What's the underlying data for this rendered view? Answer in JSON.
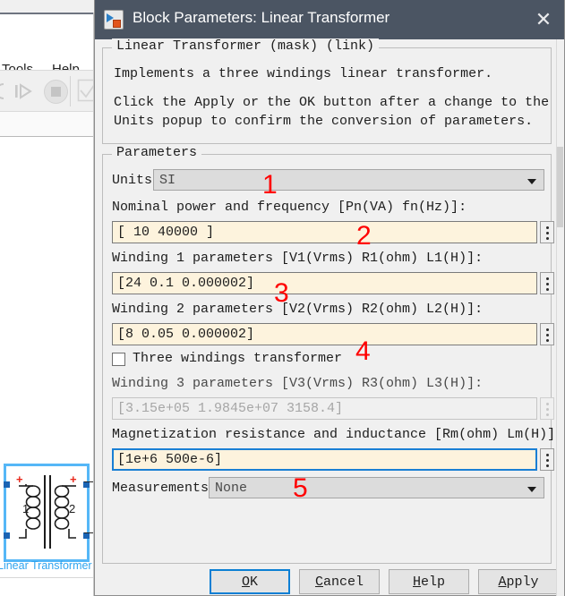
{
  "background": {
    "menus": [
      {
        "mnemonic": "T",
        "rest": "ools"
      },
      {
        "mnemonic": "H",
        "rest": "elp"
      }
    ],
    "block": {
      "label": "Linear Transformer",
      "winding1_number": "1",
      "winding2_number": "2",
      "polarity_mark": "+"
    }
  },
  "dialog": {
    "title": "Block Parameters: Linear Transformer",
    "close_label": "✕",
    "icon": "simulink-block-icon",
    "description": {
      "legend": "Linear Transformer (mask) (link)",
      "lines": [
        "Implements a three windings linear transformer.",
        "",
        "Click the Apply or the OK button after a change to the",
        "Units popup to confirm the conversion of parameters."
      ]
    },
    "parameters": {
      "legend": "Parameters",
      "units": {
        "label": "Units",
        "value": "SI"
      },
      "nominal": {
        "label": "Nominal power and frequency [Pn(VA) fn(Hz)]:",
        "value": "[ 10 40000 ]"
      },
      "winding1": {
        "label": "Winding 1 parameters [V1(Vrms) R1(ohm) L1(H)]:",
        "value": "[24 0.1 0.000002]"
      },
      "winding2": {
        "label": "Winding 2 parameters [V2(Vrms) R2(ohm) L2(H)]:",
        "value": "[8 0.05 0.000002]"
      },
      "three_windings": {
        "label": "Three windings transformer",
        "checked": false
      },
      "winding3": {
        "label": "Winding 3 parameters [V3(Vrms) R3(ohm) L3(H)]:",
        "value": "[3.15e+05 1.9845e+07 3158.4]",
        "enabled": false
      },
      "magnetization": {
        "label": "Magnetization resistance and inductance [Rm(ohm) Lm(H)]:",
        "value": "[1e+6 500e-6]"
      },
      "measurements": {
        "label": "Measurements",
        "value": "None"
      }
    },
    "buttons": {
      "ok": {
        "mnemonic": "O",
        "rest": "K"
      },
      "cancel": {
        "pre": "",
        "mnemonic": "C",
        "rest": "ancel"
      },
      "help": {
        "pre": "",
        "mnemonic": "H",
        "rest": "elp"
      },
      "apply": {
        "pre": "",
        "mnemonic": "A",
        "rest": "pply"
      }
    }
  },
  "annotations": {
    "markers": [
      "1",
      "2",
      "3",
      "4",
      "5"
    ],
    "color": "#ff0000"
  }
}
